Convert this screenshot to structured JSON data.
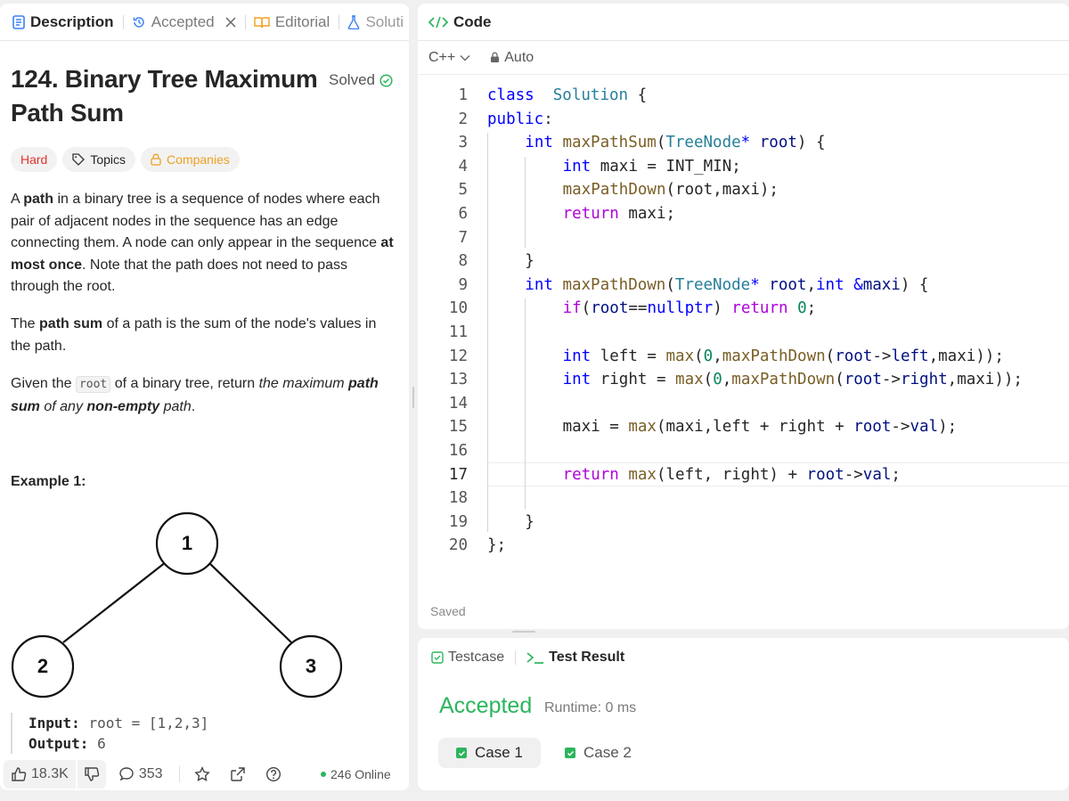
{
  "left_tabs": [
    {
      "label": "Description",
      "icon": "description-icon"
    },
    {
      "label": "Accepted",
      "icon": "history-icon"
    },
    {
      "label": "Editorial",
      "icon": "book-icon"
    },
    {
      "label": "Soluti",
      "icon": "flask-icon"
    }
  ],
  "problem": {
    "title": "124. Binary Tree Maximum Path Sum",
    "status": "Solved",
    "tags": {
      "difficulty": "Hard",
      "topics": "Topics",
      "companies": "Companies"
    },
    "para1": [
      {
        "t": "A ",
        "s": "n"
      },
      {
        "t": "path",
        "s": "b"
      },
      {
        "t": " in a binary tree is a sequence of nodes where each pair of adjacent nodes in the sequence has an edge connecting them. A node can only appear in the sequence ",
        "s": "n"
      },
      {
        "t": "at most once",
        "s": "b"
      },
      {
        "t": ". Note that the path does not need to pass through the root.",
        "s": "n"
      }
    ],
    "para2": [
      {
        "t": "The ",
        "s": "n"
      },
      {
        "t": "path sum",
        "s": "b"
      },
      {
        "t": " of a path is the sum of the node's values in the path.",
        "s": "n"
      }
    ],
    "para3": [
      {
        "t": "Given the ",
        "s": "n"
      },
      {
        "t": "root",
        "s": "c"
      },
      {
        "t": " of a binary tree, return ",
        "s": "n"
      },
      {
        "t": "the maximum ",
        "s": "i"
      },
      {
        "t": "path sum",
        "s": "bi"
      },
      {
        "t": " of any ",
        "s": "i"
      },
      {
        "t": "non-empty",
        "s": "bi"
      },
      {
        "t": " path",
        "s": "i"
      },
      {
        "t": ".",
        "s": "n"
      }
    ],
    "example_title": "Example 1:",
    "tree_nodes": [
      "1",
      "2",
      "3"
    ],
    "input_label": "Input:",
    "input_value": "root = [1,2,3]",
    "output_label": "Output:",
    "output_value": "6"
  },
  "bottom_bar": {
    "likes": "18.3K",
    "comments": "353",
    "online": "246 Online"
  },
  "code_panel": {
    "title": "Code",
    "language": "C++",
    "mode": "Auto",
    "saved": "Saved",
    "current_line": 17,
    "lines": [
      {
        "n": "1",
        "ind": 0,
        "tok": [
          [
            "kw",
            "class"
          ],
          [
            "",
            "  "
          ],
          [
            "ty",
            "Solution"
          ],
          [
            "",
            " {"
          ]
        ]
      },
      {
        "n": "2",
        "ind": 0,
        "tok": [
          [
            "kw",
            "public"
          ],
          [
            "",
            ":"
          ]
        ]
      },
      {
        "n": "3",
        "ind": 1,
        "tok": [
          [
            "kw",
            "int"
          ],
          [
            "",
            " "
          ],
          [
            "fn",
            "maxPathSum"
          ],
          [
            "",
            "("
          ],
          [
            "ty",
            "TreeNode"
          ],
          [
            "kw",
            "*"
          ],
          [
            "",
            " "
          ],
          [
            "var",
            "root"
          ],
          [
            "",
            ") {"
          ]
        ]
      },
      {
        "n": "4",
        "ind": 2,
        "tok": [
          [
            "kw",
            "int"
          ],
          [
            "",
            " maxi = INT_MIN;"
          ]
        ]
      },
      {
        "n": "5",
        "ind": 2,
        "tok": [
          [
            "fn",
            "maxPathDown"
          ],
          [
            "",
            "(root,maxi);"
          ]
        ]
      },
      {
        "n": "6",
        "ind": 2,
        "tok": [
          [
            "ctrl",
            "return"
          ],
          [
            "",
            " maxi;"
          ]
        ]
      },
      {
        "n": "7",
        "ind": 0,
        "tok": []
      },
      {
        "n": "8",
        "ind": 1,
        "tok": [
          [
            "",
            "}"
          ]
        ]
      },
      {
        "n": "9",
        "ind": 1,
        "tok": [
          [
            "kw",
            "int"
          ],
          [
            "",
            " "
          ],
          [
            "fn",
            "maxPathDown"
          ],
          [
            "",
            "("
          ],
          [
            "ty",
            "TreeNode"
          ],
          [
            "kw",
            "*"
          ],
          [
            "",
            " "
          ],
          [
            "var",
            "root"
          ],
          [
            "",
            ","
          ],
          [
            "kw",
            "int"
          ],
          [
            "",
            " "
          ],
          [
            "kw",
            "&"
          ],
          [
            "var",
            "maxi"
          ],
          [
            "",
            ") {"
          ]
        ]
      },
      {
        "n": "10",
        "ind": 2,
        "tok": [
          [
            "ctrl",
            "if"
          ],
          [
            "",
            "("
          ],
          [
            "var",
            "root"
          ],
          [
            "",
            "=="
          ],
          [
            "kw",
            "nullptr"
          ],
          [
            "",
            ") "
          ],
          [
            "ctrl",
            "return"
          ],
          [
            "",
            " "
          ],
          [
            "num",
            "0"
          ],
          [
            "",
            ";"
          ]
        ]
      },
      {
        "n": "11",
        "ind": 0,
        "tok": []
      },
      {
        "n": "12",
        "ind": 2,
        "tok": [
          [
            "kw",
            "int"
          ],
          [
            "",
            " left = "
          ],
          [
            "fn",
            "max"
          ],
          [
            "",
            "("
          ],
          [
            "num",
            "0"
          ],
          [
            "",
            ","
          ],
          [
            "fn",
            "maxPathDown"
          ],
          [
            "",
            "("
          ],
          [
            "var",
            "root"
          ],
          [
            "",
            "->"
          ],
          [
            "var",
            "left"
          ],
          [
            "",
            ",maxi));"
          ]
        ]
      },
      {
        "n": "13",
        "ind": 2,
        "tok": [
          [
            "kw",
            "int"
          ],
          [
            "",
            " right = "
          ],
          [
            "fn",
            "max"
          ],
          [
            "",
            "("
          ],
          [
            "num",
            "0"
          ],
          [
            "",
            ","
          ],
          [
            "fn",
            "maxPathDown"
          ],
          [
            "",
            "("
          ],
          [
            "var",
            "root"
          ],
          [
            "",
            "->"
          ],
          [
            "var",
            "right"
          ],
          [
            "",
            ",maxi));"
          ]
        ]
      },
      {
        "n": "14",
        "ind": 0,
        "tok": []
      },
      {
        "n": "15",
        "ind": 2,
        "tok": [
          [
            "",
            "maxi = "
          ],
          [
            "fn",
            "max"
          ],
          [
            "",
            "(maxi,left + right + "
          ],
          [
            "var",
            "root"
          ],
          [
            "",
            "->"
          ],
          [
            "var",
            "val"
          ],
          [
            "",
            ");"
          ]
        ]
      },
      {
        "n": "16",
        "ind": 0,
        "tok": []
      },
      {
        "n": "17",
        "ind": 2,
        "tok": [
          [
            "ctrl",
            "return"
          ],
          [
            "",
            " "
          ],
          [
            "fn",
            "max"
          ],
          [
            "",
            "(left, right) + "
          ],
          [
            "var",
            "root"
          ],
          [
            "",
            "->"
          ],
          [
            "var",
            "val"
          ],
          [
            "",
            ";"
          ]
        ]
      },
      {
        "n": "18",
        "ind": 0,
        "tok": []
      },
      {
        "n": "19",
        "ind": 1,
        "tok": [
          [
            "",
            "}"
          ]
        ]
      },
      {
        "n": "20",
        "ind": 0,
        "tok": [
          [
            "",
            "};"
          ]
        ]
      }
    ]
  },
  "result_panel": {
    "tab_testcase": "Testcase",
    "tab_result": "Test Result",
    "verdict": "Accepted",
    "runtime": "Runtime: 0 ms",
    "cases": [
      "Case 1",
      "Case 2"
    ]
  },
  "colors": {
    "accent_green": "#2cb55d",
    "hard_red": "#e0352b",
    "companies_orange": "#f0a020"
  }
}
